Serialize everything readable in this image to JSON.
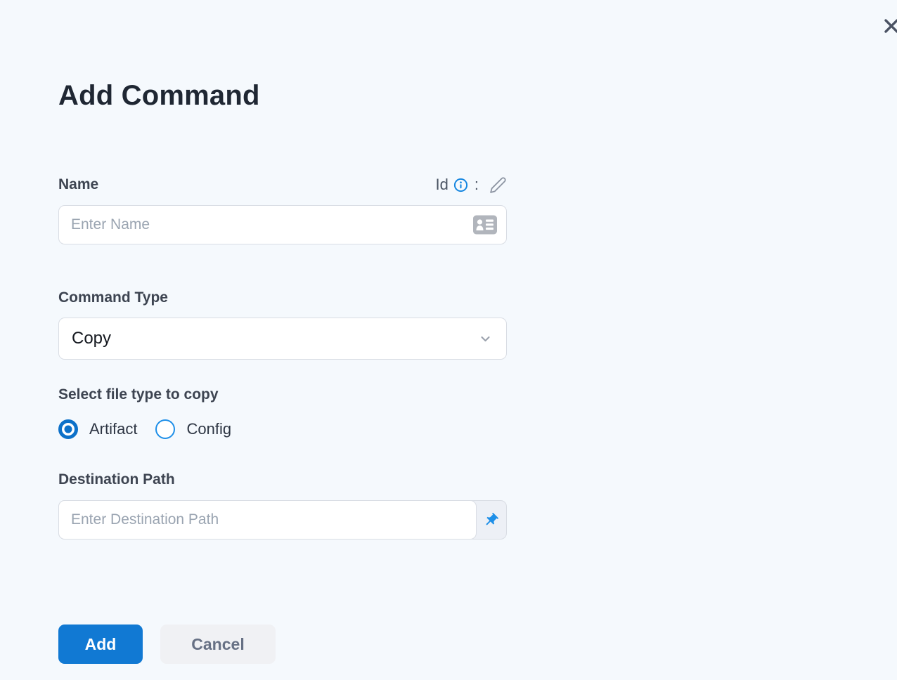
{
  "dialog": {
    "title": "Add Command"
  },
  "name_field": {
    "label": "Name",
    "id_prefix": "Id",
    "separator": ":",
    "placeholder": "Enter Name",
    "value": ""
  },
  "command_type_field": {
    "label": "Command Type",
    "value": "Copy"
  },
  "file_type_field": {
    "label": "Select file type to copy",
    "options": [
      {
        "label": "Artifact",
        "selected": true
      },
      {
        "label": "Config",
        "selected": false
      }
    ]
  },
  "destination_field": {
    "label": "Destination Path",
    "placeholder": "Enter Destination Path",
    "value": ""
  },
  "actions": {
    "add": "Add",
    "cancel": "Cancel"
  },
  "icons": {
    "close": "x-icon",
    "info": "info-circle-icon",
    "edit": "pencil-icon",
    "name_suffix": "id-card-icon",
    "select_arrow": "chevron-down-icon",
    "destination_addon": "pushpin-icon"
  },
  "colors": {
    "page_background": "#f5f9fd",
    "primary_blue": "#1179d3",
    "accent_blue": "#1e8fe8",
    "radio_blue": "#0d71c9",
    "border": "#d9dde4",
    "heading_text": "#1f2733",
    "label_text": "#3d4451",
    "placeholder_text": "#9aa4b1",
    "cancel_background": "#f0f1f4",
    "cancel_text": "#667084"
  }
}
